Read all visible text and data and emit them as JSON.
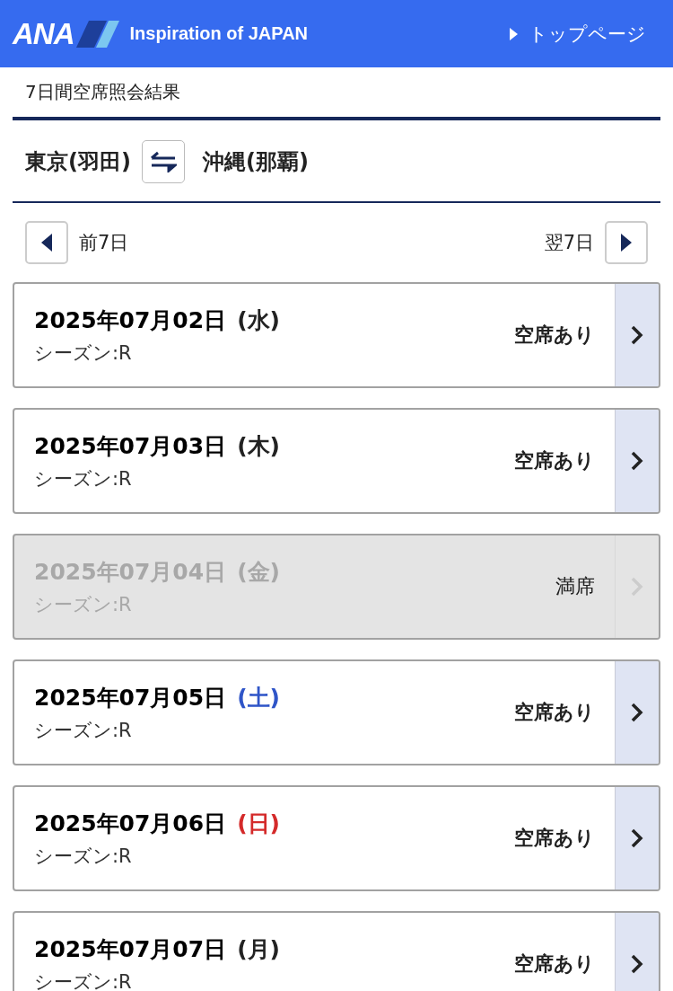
{
  "header": {
    "logo": "ANA",
    "tagline": "Inspiration of JAPAN",
    "top_link": "トップページ"
  },
  "page_title": "7日間空席照会結果",
  "route": {
    "origin": "東京(羽田)",
    "destination": "沖縄(那覇)"
  },
  "nav": {
    "prev": "前7日",
    "next": "翌7日"
  },
  "days": [
    {
      "date": "2025年07月02日",
      "weekday": "(水)",
      "color": "#222222",
      "season": "シーズン:R",
      "status": "空席あり",
      "available": true
    },
    {
      "date": "2025年07月03日",
      "weekday": "(木)",
      "color": "#222222",
      "season": "シーズン:R",
      "status": "空席あり",
      "available": true
    },
    {
      "date": "2025年07月04日",
      "weekday": "(金)",
      "color": "#a8a8a8",
      "season": "シーズン:R",
      "status": "満席",
      "available": false
    },
    {
      "date": "2025年07月05日",
      "weekday": "(土)",
      "color": "#2f55c8",
      "season": "シーズン:R",
      "status": "空席あり",
      "available": true
    },
    {
      "date": "2025年07月06日",
      "weekday": "(日)",
      "color": "#d42a2a",
      "season": "シーズン:R",
      "status": "空席あり",
      "available": true
    },
    {
      "date": "2025年07月07日",
      "weekday": "(月)",
      "color": "#222222",
      "season": "シーズン:R",
      "status": "空席あり",
      "available": true
    }
  ]
}
